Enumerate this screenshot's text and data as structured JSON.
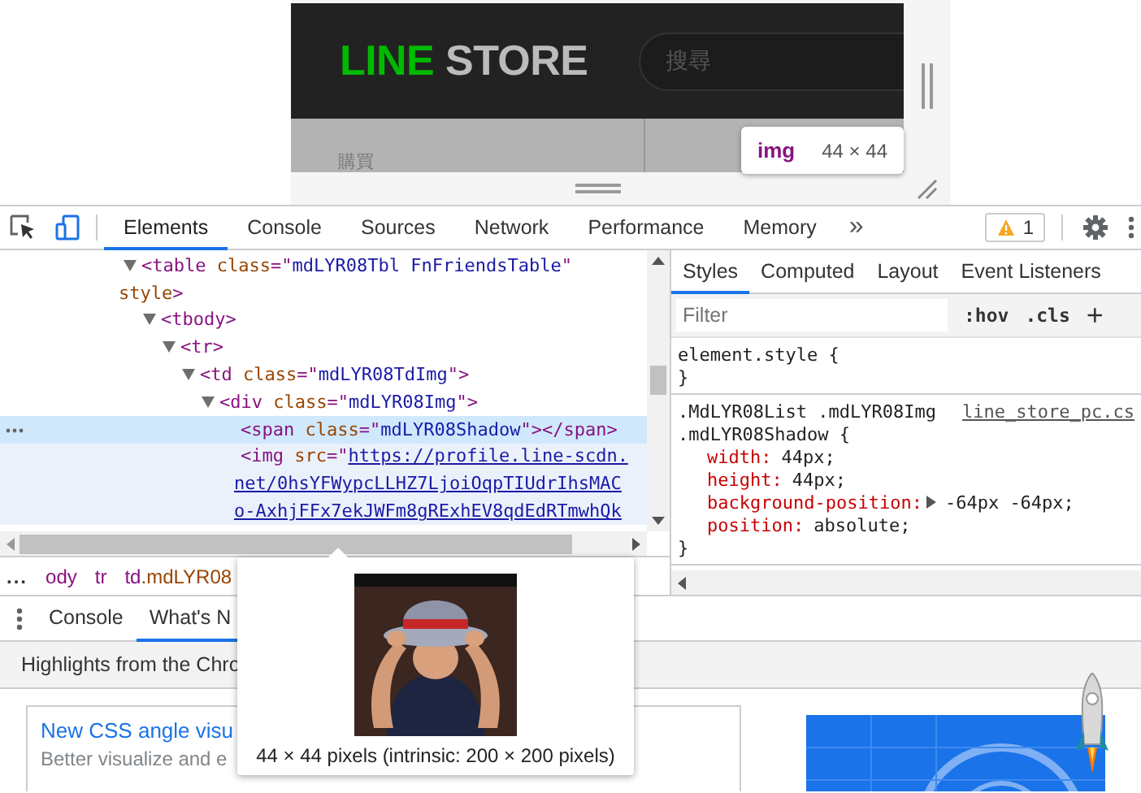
{
  "viewport": {
    "logo_left": "LINE",
    "logo_right": "STORE",
    "search": {
      "placeholder": "搜尋"
    },
    "menu_item": "購買",
    "tooltip": {
      "tag": "img",
      "size": "44 × 44"
    }
  },
  "toolbar": {
    "tabs": [
      {
        "label": "Elements",
        "selected": true
      },
      {
        "label": "Console",
        "selected": false
      },
      {
        "label": "Sources",
        "selected": false
      },
      {
        "label": "Network",
        "selected": false
      },
      {
        "label": "Performance",
        "selected": false
      },
      {
        "label": "Memory",
        "selected": false
      }
    ],
    "overflow": "»",
    "warning_count": "1"
  },
  "elements": {
    "nodes": [
      {
        "expanded": true,
        "selected": false,
        "hovered": false,
        "lines": [
          [
            {
              "kind": "tag",
              "text": "<table"
            },
            {
              "kind": "attr",
              "text": " class"
            },
            {
              "kind": "punct",
              "text": "=\""
            },
            {
              "kind": "value",
              "text": "mdLYR08Tbl FnFriendsTable"
            },
            {
              "kind": "punct",
              "text": "\""
            }
          ],
          [
            {
              "kind": "attr",
              "text": "style"
            },
            {
              "kind": "tag",
              "text": ">"
            }
          ]
        ],
        "children": [
          {
            "expanded": true,
            "selected": false,
            "hovered": false,
            "lines": [
              [
                {
                  "kind": "tag",
                  "text": "<tbody>"
                }
              ]
            ],
            "children": [
              {
                "expanded": true,
                "selected": false,
                "hovered": false,
                "lines": [
                  [
                    {
                      "kind": "tag",
                      "text": "<tr>"
                    }
                  ]
                ],
                "children": [
                  {
                    "expanded": true,
                    "selected": false,
                    "hovered": false,
                    "lines": [
                      [
                        {
                          "kind": "tag",
                          "text": "<td"
                        },
                        {
                          "kind": "attr",
                          "text": " class"
                        },
                        {
                          "kind": "punct",
                          "text": "=\""
                        },
                        {
                          "kind": "value",
                          "text": "mdLYR08TdImg"
                        },
                        {
                          "kind": "punct",
                          "text": "\">"
                        }
                      ]
                    ],
                    "children": [
                      {
                        "expanded": true,
                        "selected": false,
                        "hovered": false,
                        "lines": [
                          [
                            {
                              "kind": "tag",
                              "text": "<div"
                            },
                            {
                              "kind": "attr",
                              "text": " class"
                            },
                            {
                              "kind": "punct",
                              "text": "=\""
                            },
                            {
                              "kind": "value",
                              "text": "mdLYR08Img"
                            },
                            {
                              "kind": "punct",
                              "text": "\">"
                            }
                          ]
                        ],
                        "children": [
                          {
                            "selected": true,
                            "hovered": false,
                            "lines": [
                              [
                                {
                                  "kind": "tag",
                                  "text": "<span"
                                },
                                {
                                  "kind": "attr",
                                  "text": " class"
                                },
                                {
                                  "kind": "punct",
                                  "text": "=\""
                                },
                                {
                                  "kind": "value",
                                  "text": "mdLYR08Shadow"
                                },
                                {
                                  "kind": "punct",
                                  "text": "\">"
                                },
                                {
                                  "kind": "tag",
                                  "text": "</span>"
                                }
                              ]
                            ]
                          },
                          {
                            "selected": false,
                            "hovered": true,
                            "lines": [
                              [
                                {
                                  "kind": "tag",
                                  "text": "<img"
                                },
                                {
                                  "kind": "attr",
                                  "text": " src"
                                },
                                {
                                  "kind": "punct",
                                  "text": "=\""
                                },
                                {
                                  "kind": "link",
                                  "text": "https://profile.line-scdn."
                                }
                              ],
                              [
                                {
                                  "kind": "link",
                                  "text": "net/0hsYFWypcLLHZ7LjoiOqpTIUdrIhsMAC"
                                }
                              ],
                              [
                                {
                                  "kind": "link",
                                  "text": "o-AxhjFFx7ekJWFm8gRExhEV8qdEdRTmwhQk"
                                }
                              ]
                            ]
                          }
                        ]
                      }
                    ]
                  }
                ]
              }
            ]
          }
        ]
      }
    ]
  },
  "breadcrumbs": {
    "more": "...",
    "items": [
      {
        "tag": "ody"
      },
      {
        "tag": "tr"
      },
      {
        "tag": "td",
        "class": ".mdLYR08"
      }
    ]
  },
  "styles": {
    "tabs": [
      {
        "label": "Styles",
        "selected": true
      },
      {
        "label": "Computed",
        "selected": false
      },
      {
        "label": "Layout",
        "selected": false
      },
      {
        "label": "Event Listeners",
        "selected": false
      }
    ],
    "filter": {
      "placeholder": "Filter"
    },
    "hov": ":hov",
    "cls": ".cls",
    "add": "+",
    "rules": [
      {
        "selector": [
          "element.style {"
        ],
        "close": "}"
      },
      {
        "selector": [
          ".MdLYR08List .mdLYR08Img",
          ".mdLYR08Shadow {"
        ],
        "source": "line_store_pc.cs",
        "declarations": [
          {
            "property": "width:",
            "value": "44px;",
            "expandable": false
          },
          {
            "property": "height:",
            "value": "44px;",
            "expandable": false
          },
          {
            "property": "background-position:",
            "value": "-64px -64px;",
            "expandable": true
          },
          {
            "property": "position:",
            "value": "absolute;",
            "expandable": false
          }
        ],
        "close": "}"
      }
    ]
  },
  "drawer": {
    "tabs": [
      {
        "label": "Console",
        "selected": false
      },
      {
        "label": "What's N",
        "selected": true
      }
    ],
    "headline": "Highlights from the Chro",
    "card": {
      "title": "New CSS angle visu",
      "description": "Better visualize and e"
    }
  },
  "popup": {
    "caption": "44 × 44 pixels (intrinsic: 200 × 200 pixels)"
  }
}
